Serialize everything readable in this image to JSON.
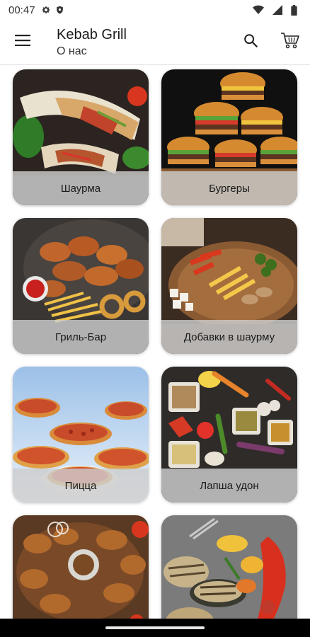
{
  "status_bar": {
    "time": "00:47",
    "icons": [
      "gear-icon",
      "shield-icon",
      "wifi-icon",
      "signal-icon",
      "battery-icon"
    ]
  },
  "app_bar": {
    "title": "Kebab Grill",
    "subtitle": "О нас",
    "icons": [
      "menu-icon",
      "search-icon",
      "cart-icon"
    ]
  },
  "categories": [
    {
      "label": "Шаурма"
    },
    {
      "label": "Бургеры"
    },
    {
      "label": "Гриль-Бар"
    },
    {
      "label": "Добавки в шаурму"
    },
    {
      "label": "Пицца"
    },
    {
      "label": "Лапша удон"
    },
    {
      "label": ""
    },
    {
      "label": ""
    }
  ]
}
